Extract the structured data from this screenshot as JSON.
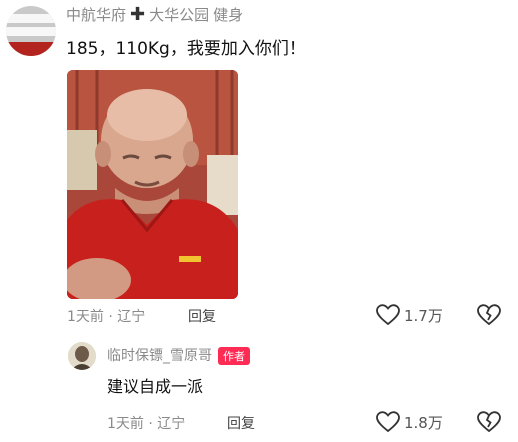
{
  "comment": {
    "user_name": "中航华府",
    "location_tag": "大华公园",
    "activity_tag": "健身",
    "text": "185，110Kg，我要加入你们！",
    "time": "1天前",
    "region": "辽宁",
    "reply_label": "回复",
    "likes": "1.7万"
  },
  "reply": {
    "user_name": "临时保镖_雪原哥",
    "author_badge": "作者",
    "text": "建议自成一派",
    "time": "1天前",
    "region": "辽宁",
    "reply_label": "回复",
    "likes": "1.8万"
  },
  "icons": {
    "like": "heart-outline-icon",
    "dislike": "broken-heart-icon",
    "plus": "plus-icon"
  },
  "colors": {
    "badge": "#fe2c55",
    "meta_text": "#8a8a8a"
  }
}
